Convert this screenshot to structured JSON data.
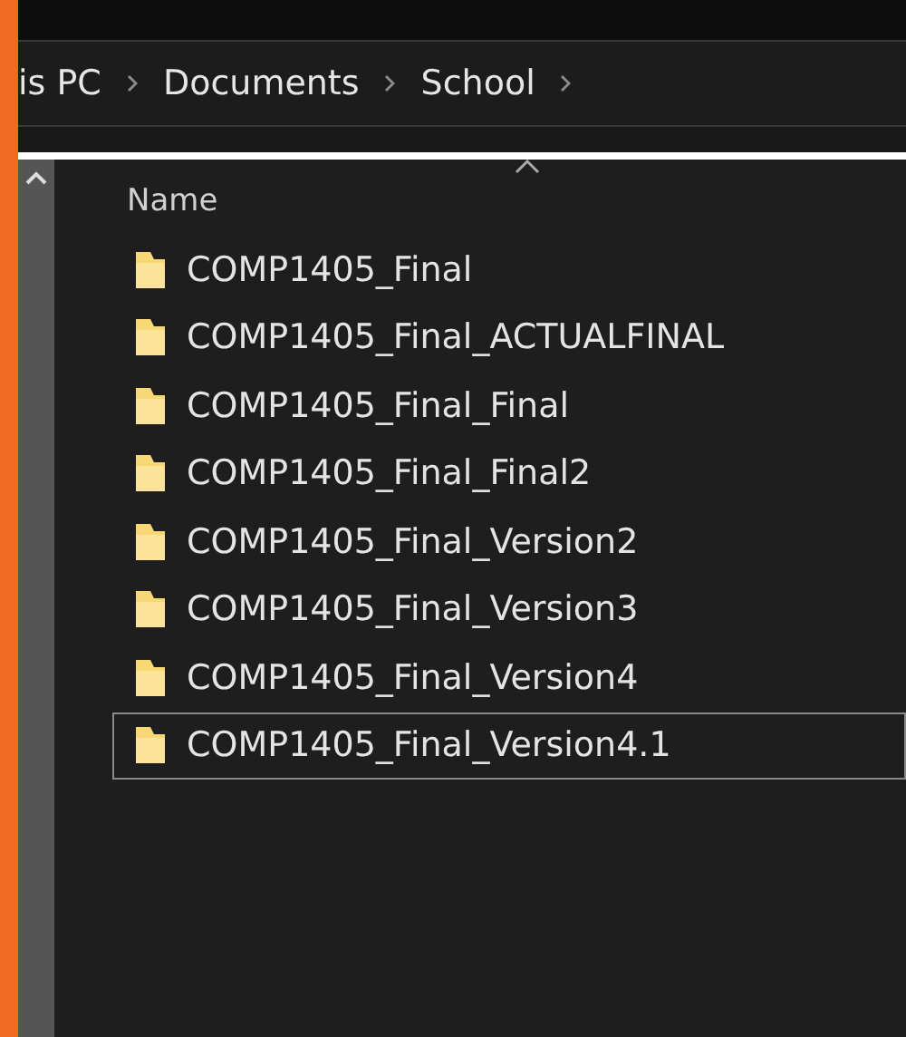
{
  "breadcrumb": [
    {
      "label": "is PC"
    },
    {
      "label": "Documents"
    },
    {
      "label": "School"
    }
  ],
  "column_header": {
    "label": "Name"
  },
  "folders": [
    {
      "name": "COMP1405_Final",
      "focused": false
    },
    {
      "name": "COMP1405_Final_ACTUALFINAL",
      "focused": false
    },
    {
      "name": "COMP1405_Final_Final",
      "focused": false
    },
    {
      "name": "COMP1405_Final_Final2",
      "focused": false
    },
    {
      "name": "COMP1405_Final_Version2",
      "focused": false
    },
    {
      "name": "COMP1405_Final_Version3",
      "focused": false
    },
    {
      "name": "COMP1405_Final_Version4",
      "focused": false
    },
    {
      "name": "COMP1405_Final_Version4.1",
      "focused": true
    }
  ]
}
